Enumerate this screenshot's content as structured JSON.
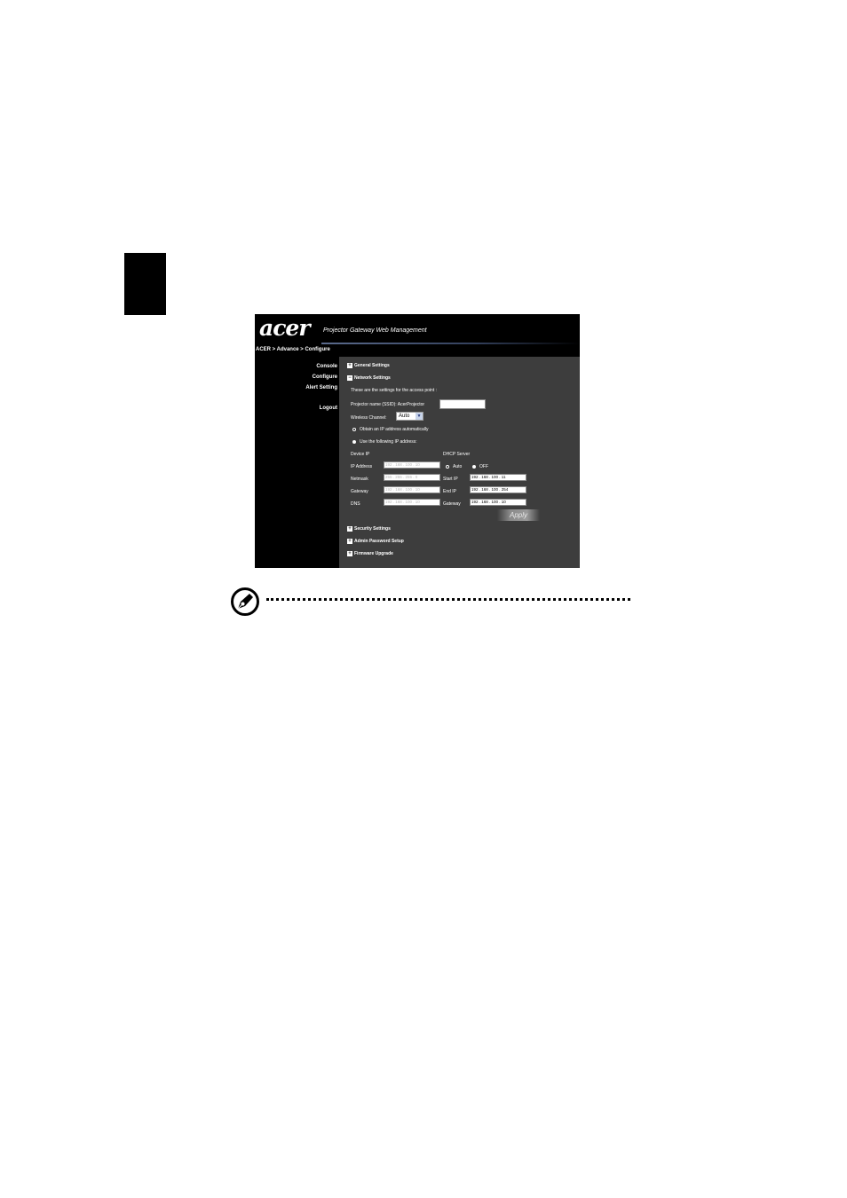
{
  "header": {
    "logo": "acer",
    "app_title": "Projector Gateway Web Management",
    "breadcrumb": "ACER > Advance > Configure"
  },
  "nav": {
    "items": [
      "Console",
      "Configure",
      "Alert Setting",
      "Logout"
    ]
  },
  "sections": {
    "general": "General Settings",
    "network": "Network Settings",
    "security": "Security Settings",
    "admin": "Admin Password Setup",
    "firmware": "Firmware Upgrade"
  },
  "network": {
    "intro": "These are the settings for the access point :",
    "ssid_label": "Projector name (SSID): AcerProjector",
    "ssid_value": "",
    "channel_label": "Wireless Channel:",
    "channel_value": "Auto",
    "obtain_auto_label": "Obtain an IP address automatically",
    "use_following_label": "Use the following IP address:",
    "device_ip_title": "Device IP",
    "dhcp_title": "DHCP Server",
    "labels": {
      "ip": "IP Address",
      "netmask": "Netmask",
      "gateway": "Gateway",
      "dns": "DNS"
    },
    "device": {
      "ip": "192 . 168 . 100 . 10",
      "netmask": "255 . 255 . 255 . 0",
      "gateway": "192 . 168 . 100 . 10",
      "dns": "192 . 168 . 100 . 10"
    },
    "dhcp_auto": "Auto",
    "dhcp_off": "OFF",
    "dhcp_labels": {
      "start": "Start IP",
      "end": "End IP",
      "gateway": "Gateway"
    },
    "dhcp": {
      "start": "192 . 168 . 100 . 11",
      "end": "192 . 168 . 100 . 254",
      "gateway": "192 . 168 . 100 . 10"
    },
    "apply": "Apply"
  }
}
